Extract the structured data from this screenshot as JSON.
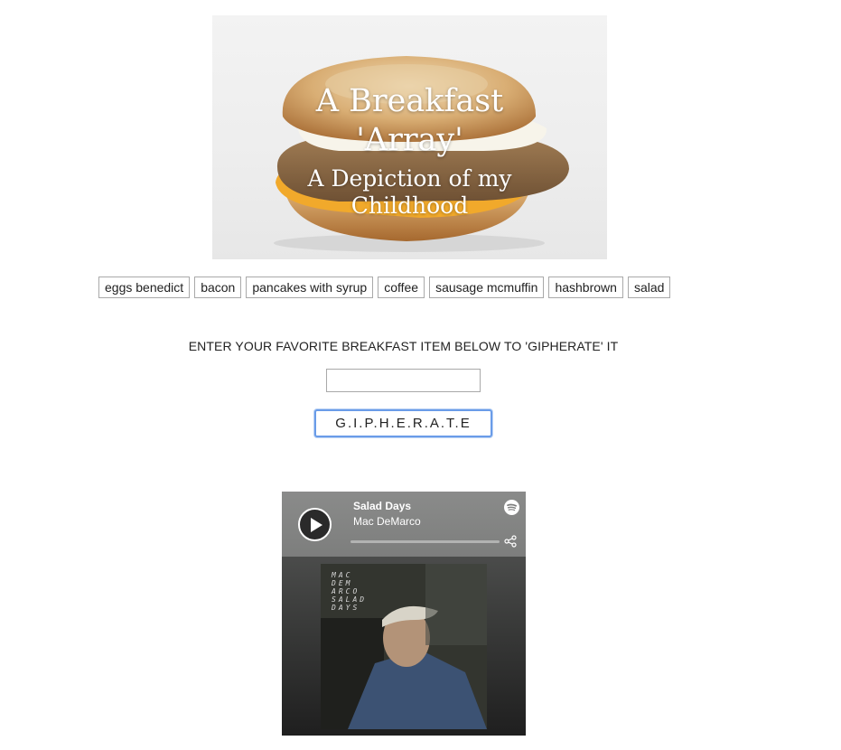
{
  "hero": {
    "title": "A Breakfast 'Array'",
    "subtitle": "A Depiction of my Childhood"
  },
  "items": [
    {
      "label": "eggs benedict"
    },
    {
      "label": "bacon"
    },
    {
      "label": "pancakes with syrup"
    },
    {
      "label": "coffee"
    },
    {
      "label": "sausage mcmuffin"
    },
    {
      "label": "hashbrown"
    },
    {
      "label": "salad"
    }
  ],
  "search": {
    "prompt": "ENTER YOUR FAVORITE BREAKFAST ITEM BELOW TO 'GIPHERATE' IT",
    "value": "",
    "button_label": "G.I.P.H.E.R.A.T.E"
  },
  "player": {
    "track_title": "Salad Days",
    "artist": "Mac DeMarco",
    "album_lettering": "MAC\nDEM\nARCO\nSALAD\nDAYS",
    "progress": 0,
    "icons": {
      "play": "play-icon",
      "brand": "spotify-icon",
      "share": "share-icon"
    },
    "colors": {
      "header": "#7d7e7d",
      "body_top": "#5c5d5c",
      "body_bottom": "#1f1f1f"
    }
  },
  "colors": {
    "button_focus_ring": "#6a9ce8",
    "border": "#a9a9a9"
  }
}
